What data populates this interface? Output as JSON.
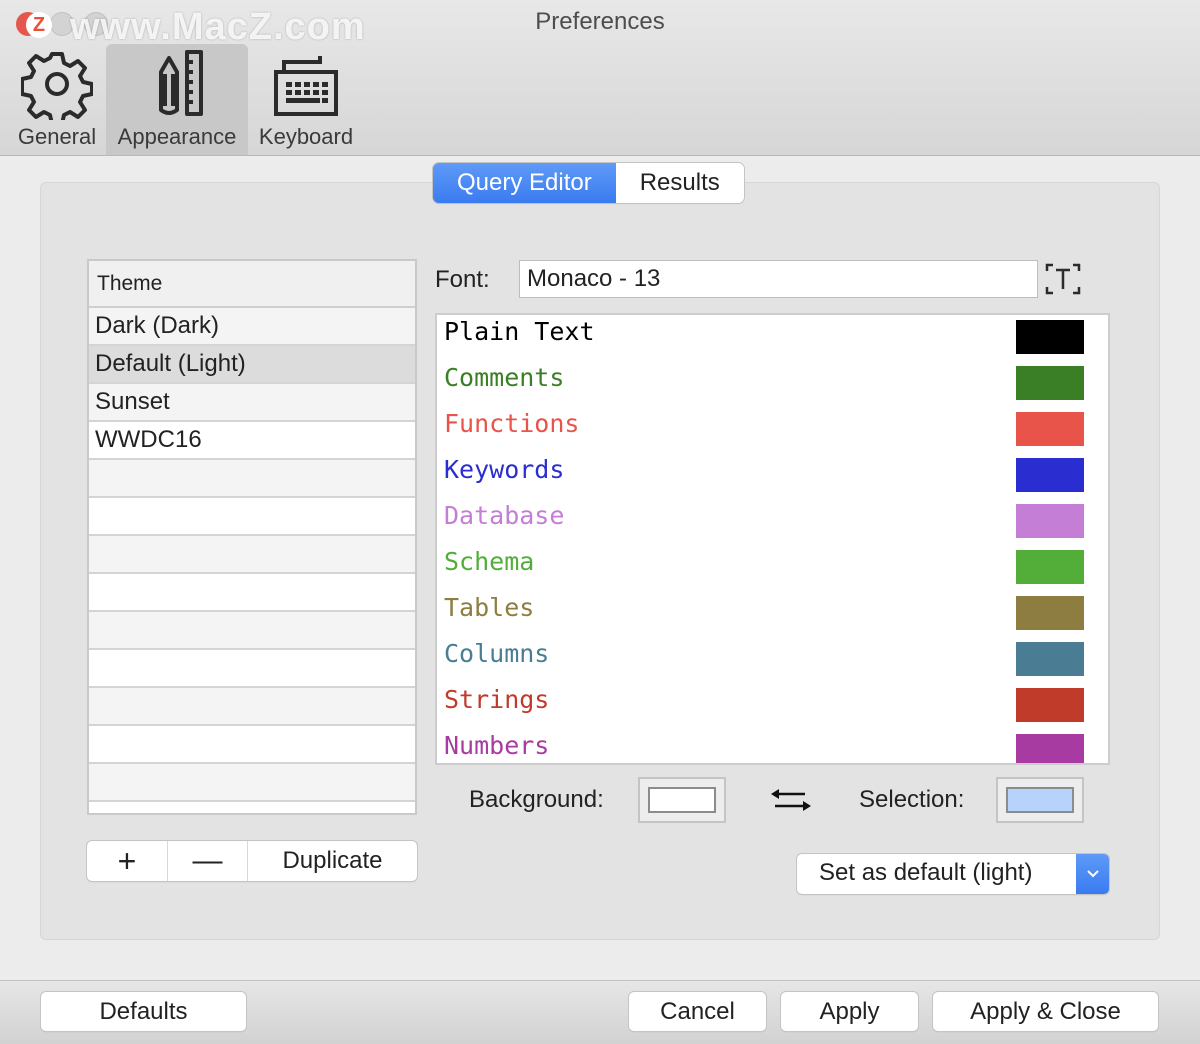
{
  "window": {
    "title": "Preferences",
    "watermark": "www.MacZ.com",
    "watermark_badge": "Z"
  },
  "toolbar": {
    "items": [
      {
        "label": "General",
        "icon": "gear-icon",
        "selected": false
      },
      {
        "label": "Appearance",
        "icon": "pencil-ruler-icon",
        "selected": true
      },
      {
        "label": "Keyboard",
        "icon": "keyboard-icon",
        "selected": false
      }
    ]
  },
  "tabs": {
    "items": [
      {
        "label": "Query Editor",
        "active": true
      },
      {
        "label": "Results",
        "active": false
      }
    ]
  },
  "themes": {
    "header": "Theme",
    "items": [
      "Dark (Dark)",
      "Default (Light)",
      "Sunset",
      "WWDC16"
    ],
    "selected": "Default (Light)",
    "add_label": "+",
    "remove_label": "—",
    "duplicate_label": "Duplicate"
  },
  "font": {
    "label": "Font:",
    "value": "Monaco - 13",
    "picker_icon": "font-picker-icon"
  },
  "syntax": [
    {
      "name": "Plain Text",
      "color": "#000000"
    },
    {
      "name": "Comments",
      "color": "#3a7f25"
    },
    {
      "name": "Functions",
      "color": "#e8534a"
    },
    {
      "name": "Keywords",
      "color": "#2a2ed0"
    },
    {
      "name": "Database",
      "color": "#c57ed6"
    },
    {
      "name": "Schema",
      "color": "#52ae39"
    },
    {
      "name": "Tables",
      "color": "#8e7d40"
    },
    {
      "name": "Columns",
      "color": "#4a7d94"
    },
    {
      "name": "Strings",
      "color": "#c13b2a"
    },
    {
      "name": "Numbers",
      "color": "#a83ba2"
    }
  ],
  "colors": {
    "background_label": "Background:",
    "background_color": "#ffffff",
    "selection_label": "Selection:",
    "selection_color": "#b8d3fb",
    "swap_icon": "swap-arrows-icon"
  },
  "default_popup": {
    "value": "Set as default (light)"
  },
  "footer": {
    "defaults_label": "Defaults",
    "cancel_label": "Cancel",
    "apply_label": "Apply",
    "apply_close_label": "Apply & Close"
  }
}
